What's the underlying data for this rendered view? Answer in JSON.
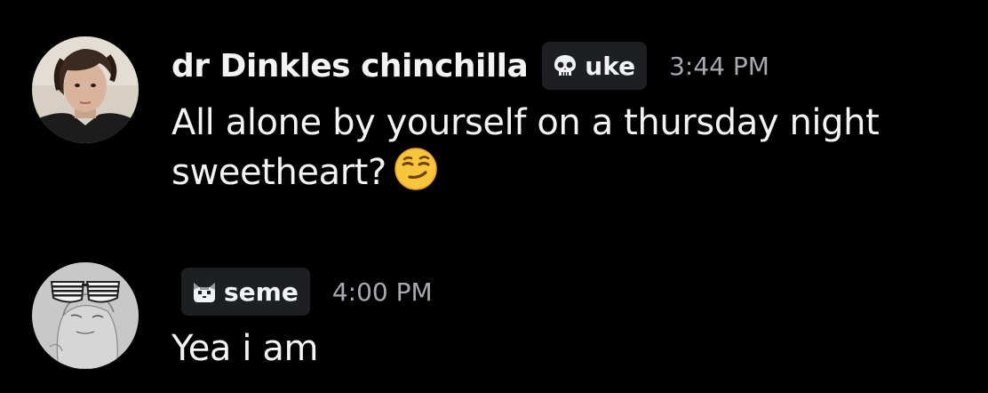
{
  "messages": [
    {
      "username": "dr Dinkles chinchilla",
      "tag": {
        "icon": "skull-icon",
        "label": "uke"
      },
      "timestamp": "3:44 PM",
      "lines": [
        "All alone by yourself on a thursday night",
        "sweetheart?"
      ],
      "emoji": "smirking-face-emoji"
    },
    {
      "username": "",
      "tag": {
        "icon": "cat-icon",
        "label": "seme"
      },
      "timestamp": "4:00 PM",
      "lines": [
        "Yea i am"
      ]
    }
  ],
  "colors": {
    "background": "#000000",
    "text": "#f2f3f5",
    "timestamp": "#a7a9b0",
    "tag_bg": "#1e1f22"
  }
}
